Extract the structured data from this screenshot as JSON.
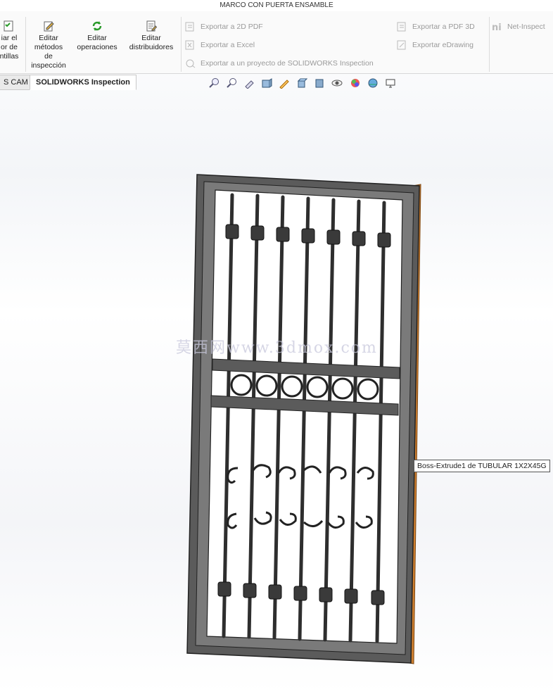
{
  "window": {
    "title": "MARCO CON PUERTA ENSAMBLE"
  },
  "ribbon": {
    "partial_button": {
      "line1": "iar el",
      "line2": "or de",
      "line3": "ntillas"
    },
    "edit_methods": {
      "line1": "Editar",
      "line2": "métodos",
      "line3": "de",
      "line4": "inspección"
    },
    "edit_operations": {
      "line1": "Editar",
      "line2": "operaciones"
    },
    "edit_distributors": {
      "line1": "Editar",
      "line2": "distribuidores"
    },
    "export_2d_pdf": "Exportar a 2D PDF",
    "export_excel": "Exportar a Excel",
    "export_project": "Exportar a un proyecto de SOLIDWORKS Inspection",
    "export_3d_pdf": "Exportar a PDF 3D",
    "export_edrawing": "Exportar eDrawing",
    "net_inspect": "Net-Inspect"
  },
  "tabs": [
    {
      "label": "S CAM"
    },
    {
      "label": "SOLIDWORKS Inspection"
    }
  ],
  "view_toolbar": {
    "icons": [
      "zoom-to-fit-icon",
      "zoom-to-area-icon",
      "previous-view-icon",
      "section-view-icon",
      "dynamic-annotation-icon",
      "view-orientation-icon",
      "display-style-icon",
      "hide-show-icon",
      "edit-appearance-icon",
      "apply-scene-icon",
      "view-settings-icon"
    ]
  },
  "tooltip": {
    "text": "Boss-Extrude1 de TUBULAR 1X2X45G"
  },
  "watermark": {
    "text": "莫西网www.3dmox.com"
  },
  "colors": {
    "frame": "#5a5a5a",
    "frame_light": "#7a7a7a",
    "bars": "#333333",
    "accent_edge": "#d08030"
  }
}
